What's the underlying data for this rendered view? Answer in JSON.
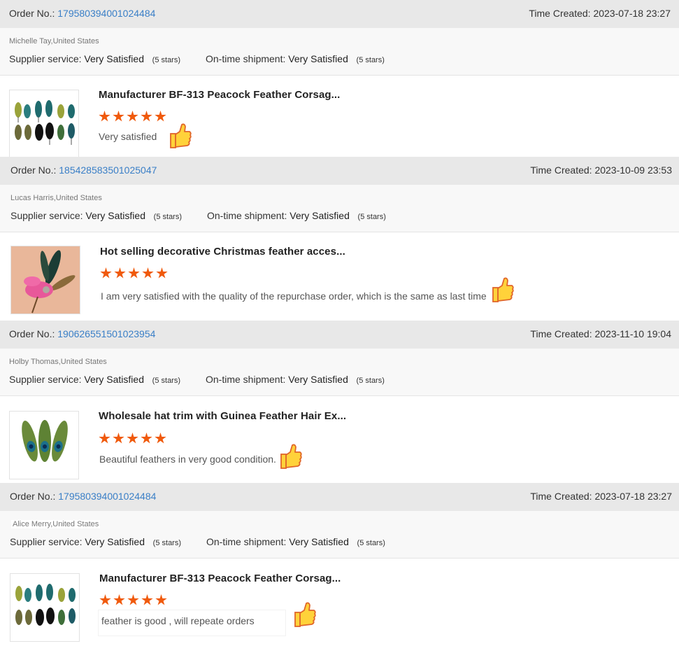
{
  "labels": {
    "order_no": "Order No.:",
    "time_created": "Time Created:",
    "supplier_service": "Supplier service:",
    "ontime_shipment": "On-time shipment:",
    "stars_note": "(5 stars)",
    "satisfaction": "Very Satisfied"
  },
  "reviews": [
    {
      "order_no": "179580394001024484",
      "time": "2023-07-18 23:27",
      "buyer": "Michelle Tay,United States",
      "product": "Manufacturer BF-313 Peacock Feather Corsag...",
      "rating": 5,
      "comment": "Very satisfied",
      "image": "peacock-feathers-grid-image"
    },
    {
      "order_no": "185428583501025047",
      "time": "2023-10-09 23:53",
      "buyer": "Lucas Harris,United States",
      "product": "Hot selling decorative Christmas feather acces...",
      "rating": 5,
      "comment": "I am very satisfied with the quality of the repurchase order, which is the same as last time",
      "image": "pink-feather-accessory-image"
    },
    {
      "order_no": "190626551501023954",
      "time": "2023-11-10 19:04",
      "buyer": "Holby Thomas,United States",
      "product": "Wholesale hat trim with Guinea Feather Hair Ex...",
      "rating": 5,
      "comment": "Beautiful feathers in very good condition.",
      "image": "peacock-eye-feathers-image"
    },
    {
      "order_no": "179580394001024484",
      "time": "2023-07-18 23:27",
      "buyer": "Alice Merry,United States",
      "product": "Manufacturer BF-313 Peacock Feather Corsag...",
      "rating": 5,
      "comment": "feather is good , will repeate orders",
      "image": "peacock-feathers-grid-image"
    }
  ],
  "icons": {
    "star": "star-icon",
    "like": "thumbs-up-icon"
  },
  "colors": {
    "link": "#3a7fc7",
    "star": "#f05a0c",
    "bar": "#e8e8e8"
  }
}
